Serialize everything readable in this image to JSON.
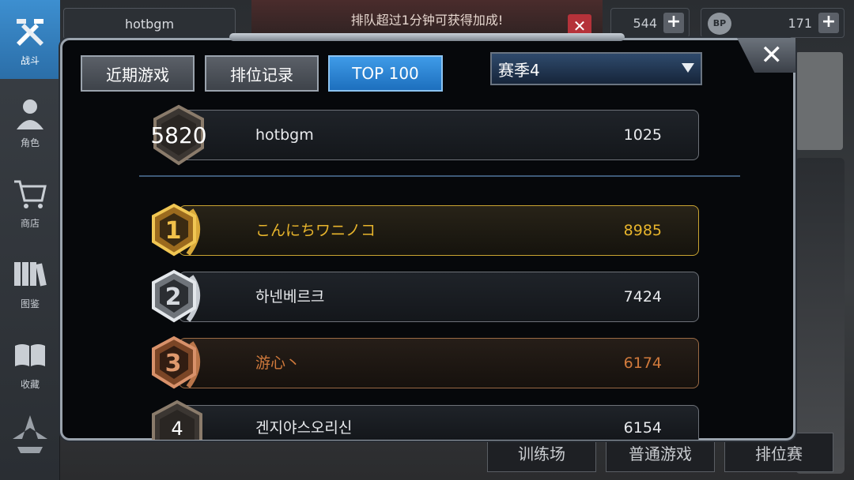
{
  "background": {
    "username": "hotbgm",
    "banner_text": "排队超过1分钟可获得加成!",
    "banner_close": "✕",
    "currency_1": "544",
    "currency_2": "171",
    "currency_2_icon": "BP",
    "plus": "+",
    "bottom_buttons": [
      "训练场",
      "普通游戏",
      "排位赛"
    ]
  },
  "sidebar": {
    "items": [
      {
        "label": "战斗",
        "icon": "crossed-guns-icon"
      },
      {
        "label": "角色",
        "icon": "character-icon"
      },
      {
        "label": "商店",
        "icon": "cart-icon"
      },
      {
        "label": "图鉴",
        "icon": "books-icon"
      },
      {
        "label": "收藏",
        "icon": "open-book-icon"
      }
    ]
  },
  "modal": {
    "close_label": "✕",
    "tabs": [
      {
        "label": "近期游戏"
      },
      {
        "label": "排位记录"
      },
      {
        "label": "TOP 100"
      }
    ],
    "season": {
      "selected": "赛季4"
    },
    "own_rank": {
      "rank": "5820",
      "name": "hotbgm",
      "score": "1025"
    },
    "leaderboard": [
      {
        "rank": "1",
        "name": "こんにちワニノコ",
        "score": "8985"
      },
      {
        "rank": "2",
        "name": "하넨베르크",
        "score": "7424"
      },
      {
        "rank": "3",
        "name": "游心丶",
        "score": "6174"
      },
      {
        "rank": "4",
        "name": "겐지야스오리신",
        "score": "6154"
      }
    ]
  },
  "colors": {
    "gold": "#e8b52c",
    "silver": "#c8ccd2",
    "bronze": "#d17a3c",
    "active_tab": "#2a86d6"
  }
}
